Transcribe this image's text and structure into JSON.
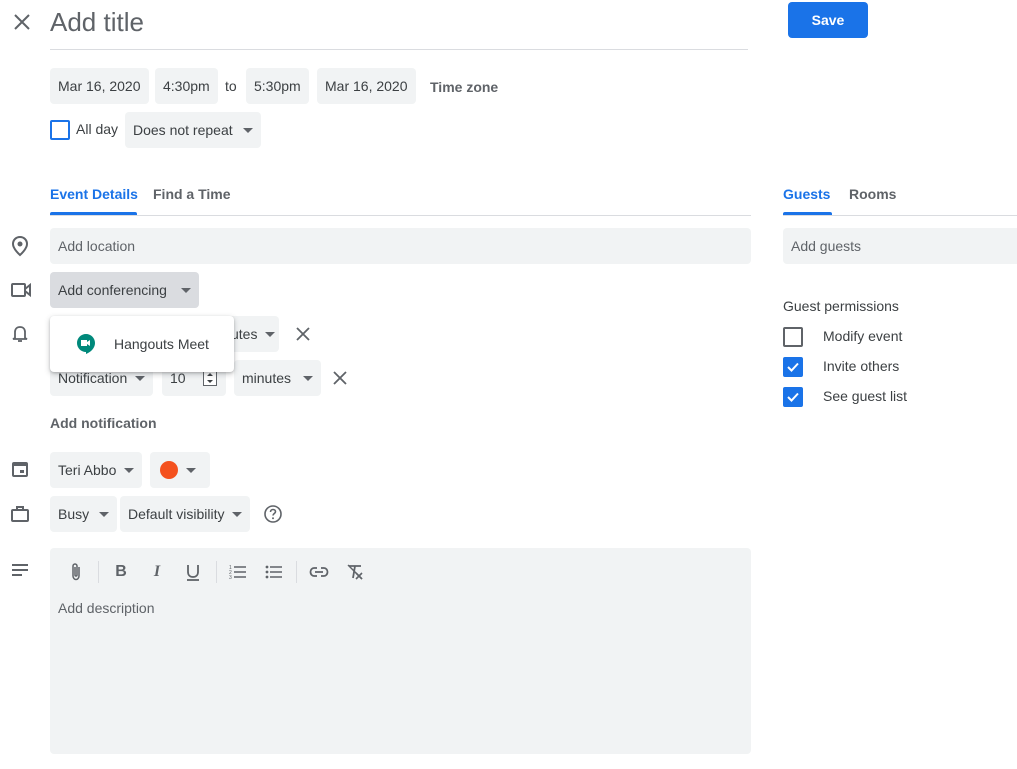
{
  "header": {
    "title_placeholder": "Add title",
    "save_label": "Save"
  },
  "datetime": {
    "start_date": "Mar 16, 2020",
    "start_time": "4:30pm",
    "to_label": "to",
    "end_time": "5:30pm",
    "end_date": "Mar 16, 2020",
    "timezone_label": "Time zone"
  },
  "allday": {
    "label": "All day",
    "checked": false,
    "repeat_value": "Does not repeat"
  },
  "tabs": {
    "event_details": "Event Details",
    "find_time": "Find a Time",
    "guests": "Guests",
    "rooms": "Rooms"
  },
  "details": {
    "location_placeholder": "Add location",
    "conferencing_label": "Add conferencing",
    "conferencing_option": "Hangouts Meet",
    "hidden_unit_fragment": "utes",
    "notification": {
      "type": "Notification",
      "amount": "10",
      "unit": "minutes"
    },
    "add_notification": "Add notification",
    "calendar_owner": "Teri Abbo",
    "calendar_color": "#f4511e",
    "availability": "Busy",
    "visibility": "Default visibility",
    "description_placeholder": "Add description"
  },
  "guests": {
    "add_placeholder": "Add guests",
    "permissions_title": "Guest permissions",
    "permissions": [
      {
        "label": "Modify event",
        "checked": false
      },
      {
        "label": "Invite others",
        "checked": true
      },
      {
        "label": "See guest list",
        "checked": true
      }
    ]
  },
  "colors": {
    "accent": "#1a73e8",
    "chip_bg": "#f1f3f4",
    "meet_green": "#00897b"
  },
  "toolbar_icons": [
    "attachment-icon",
    "bold-icon",
    "italic-icon",
    "underline-icon",
    "numbered-list-icon",
    "bulleted-list-icon",
    "link-icon",
    "remove-formatting-icon"
  ]
}
